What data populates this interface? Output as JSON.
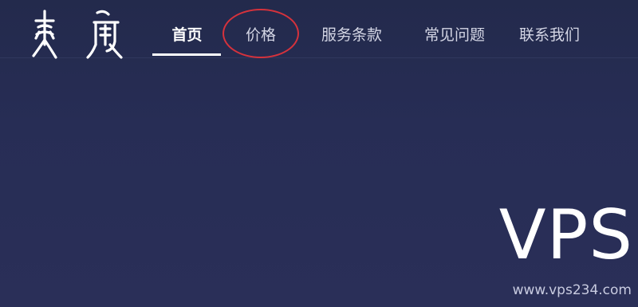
{
  "header": {
    "logo_icon": "seal-script-logo-icon",
    "nav": [
      {
        "label": "首页",
        "active": true
      },
      {
        "label": "价格",
        "active": false,
        "highlighted": true
      },
      {
        "label": "服务条款",
        "active": false
      },
      {
        "label": "常见问题",
        "active": false
      },
      {
        "label": "联系我们",
        "active": false
      }
    ]
  },
  "watermark": {
    "big": "VPS",
    "url": "www.vps234.com"
  },
  "colors": {
    "background": "#262c50",
    "nav_text": "#d3d5e4",
    "nav_active": "#ffffff",
    "annotation": "#d6323c"
  }
}
